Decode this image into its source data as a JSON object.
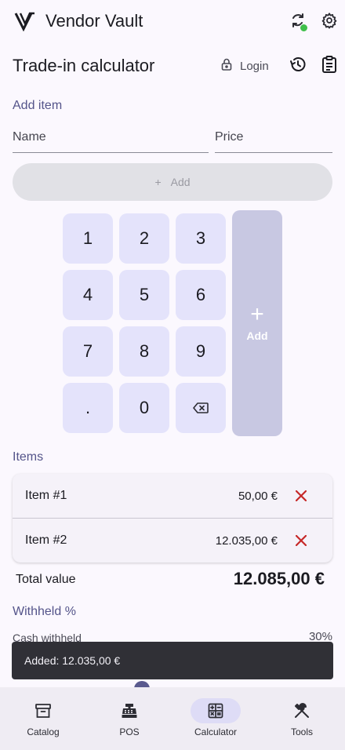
{
  "app": {
    "title": "Vendor Vault"
  },
  "header": {
    "title": "Trade-in calculator",
    "login_label": "Login"
  },
  "add_item": {
    "section_label": "Add item",
    "name_placeholder": "Name",
    "price_placeholder": "Price",
    "add_button_label": "Add"
  },
  "keypad": {
    "keys": [
      "1",
      "2",
      "3",
      "4",
      "5",
      "6",
      "7",
      "8",
      "9",
      ".",
      "0"
    ],
    "backspace_icon": "backspace-icon",
    "add_plus": "+",
    "add_label": "Add"
  },
  "items": {
    "section_label": "Items",
    "rows": [
      {
        "name": "Item #1",
        "price": "50,00 €"
      },
      {
        "name": "Item #2",
        "price": "12.035,00 €"
      }
    ]
  },
  "total": {
    "label": "Total value",
    "value": "12.085,00 €"
  },
  "withheld": {
    "section_label": "Withheld %",
    "cash_label": "Cash withheld",
    "cash_value": "30%"
  },
  "snackbar": {
    "message": "Added: 12.035,00 €"
  },
  "nav": {
    "items": [
      {
        "label": "Catalog",
        "icon": "archive-icon",
        "active": false
      },
      {
        "label": "POS",
        "icon": "cash-register-icon",
        "active": false
      },
      {
        "label": "Calculator",
        "icon": "calculator-icon",
        "active": true
      },
      {
        "label": "Tools",
        "icon": "tools-icon",
        "active": false
      }
    ]
  },
  "colors": {
    "accent": "#54548a",
    "keypad_bg": "#e4e3fb",
    "delete_red": "#c62828",
    "status_green": "#3fbf4a",
    "snackbar_bg": "#303036"
  }
}
